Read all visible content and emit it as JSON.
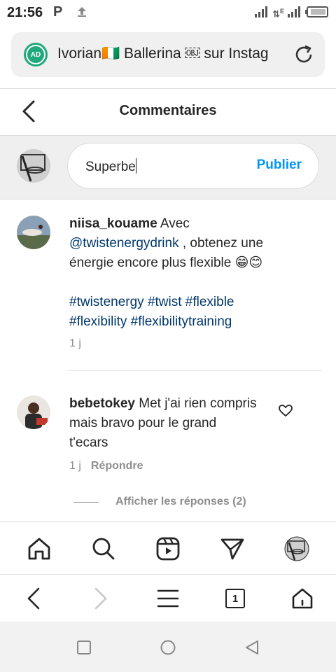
{
  "status_bar": {
    "time": "21:56",
    "p_icon": "P",
    "network_label": "E"
  },
  "browser": {
    "ad_badge": "AD",
    "url_title": "Ivorian🇨🇮 Ballerina ￼ sur Instag"
  },
  "header": {
    "title": "Commentaires"
  },
  "compose": {
    "input_value": "Superbe",
    "publish_label": "Publier"
  },
  "comments": [
    {
      "username": "niisa_kouame",
      "text_before_mention": " Avec",
      "mention": "@twistenergydrink",
      "text_after_mention": " , obtenez une énergie encore plus flexible 😁😊",
      "hashtags_line1": "#twistenergy #twist #flexible",
      "hashtags_line2": "#flexibility #flexibilitytraining",
      "time": "1 j"
    },
    {
      "username": "bebetokey",
      "text": " Met j'ai rien compris mais bravo pour le grand t'ecars",
      "time": "1 j",
      "reply_label": "Répondre",
      "view_replies": "Afficher les réponses (2)"
    }
  ],
  "browser_nav": {
    "tab_count": "1"
  },
  "icons": {
    "accent": "#0095f6",
    "ad_green": "#1fa97c",
    "link_blue": "#00376b"
  }
}
